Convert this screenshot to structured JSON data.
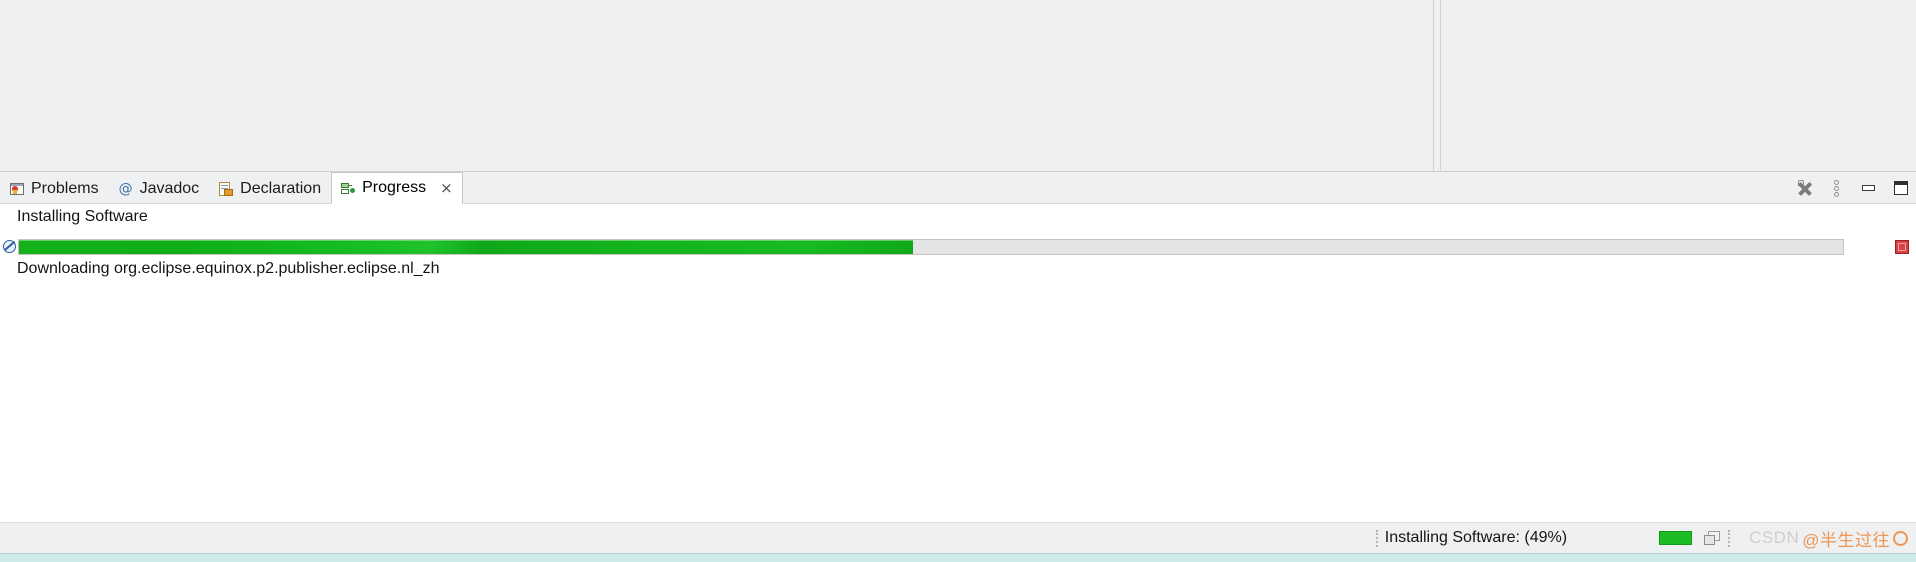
{
  "window": {
    "background_color": "#eff0f1",
    "view_background_color": "#ffffff"
  },
  "editor_area": {
    "left_pane_name": "editor-pane-left",
    "right_pane_name": "editor-pane-right"
  },
  "view_stack": {
    "tabs": [
      {
        "label": "Problems",
        "icon": "problems-icon",
        "active": false,
        "closable": false
      },
      {
        "label": "Javadoc",
        "icon": "javadoc-icon",
        "active": false,
        "closable": false
      },
      {
        "label": "Declaration",
        "icon": "declaration-icon",
        "active": false,
        "closable": false
      },
      {
        "label": "Progress",
        "icon": "progress-icon",
        "active": true,
        "closable": true
      }
    ],
    "close_glyph": "×",
    "toolbar": [
      {
        "name": "remove-all-finished-operations-button",
        "icon": "remove-all-icon"
      },
      {
        "name": "view-menu-button",
        "icon": "view-menu-icon"
      },
      {
        "name": "minimize-view-button",
        "icon": "minimize-icon"
      },
      {
        "name": "maximize-view-button",
        "icon": "maximize-icon"
      }
    ]
  },
  "progress_view": {
    "job_title": "Installing Software",
    "job_subtask": "Downloading org.eclipse.equinox.p2.publisher.eclipse.nl_zh",
    "progress_percent": 49,
    "progress_fill_color": "#13b219",
    "progress_track_color": "#e4e4e4",
    "cancel_icon": "cancel-operation-icon",
    "stop_button_color": "#d94141",
    "stop_button_name": "stop-operation-button"
  },
  "status_bar": {
    "job_status_text": "Installing Software: (49%)",
    "mini_progress_percent": 49,
    "mini_progress_color": "#1dbb24",
    "jobs_icon": "background-jobs-icon",
    "watermark": {
      "brand": "CSDN",
      "handle": "@半生过往",
      "brand_color": "#c8c8c8",
      "handle_color": "#ef8336"
    }
  }
}
